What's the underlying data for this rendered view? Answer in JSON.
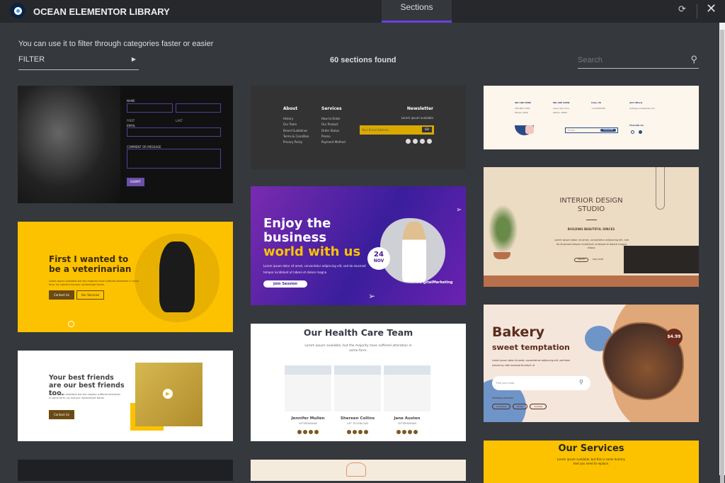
{
  "header": {
    "title": "OCEAN ELEMENTOR LIBRARY",
    "tab": "Sections",
    "sync_icon": "sync-icon",
    "close_icon": "close-icon"
  },
  "toolbar": {
    "hint": "You can use it to filter through categories faster or easier",
    "filter_label": "FILTER",
    "results": "60 sections found",
    "search_placeholder": "Search"
  },
  "colors": {
    "accent": "#6b3fe0",
    "header_bg": "#26282c",
    "body_bg": "#35383d"
  },
  "cards": {
    "contact": {
      "name_label": "NAME",
      "first": "FIRST",
      "last": "LAST",
      "email": "EMAIL",
      "comment": "COMMENT OR MESSAGE",
      "submit": "SUBMIT"
    },
    "vet": {
      "title": "First I wanted to be a veterinarian",
      "text": "Lorem ipsum available but the majority have suffered alteration in some form, by injected humour randomised words.",
      "btn1": "Contact Us",
      "btn2": "Our Services"
    },
    "friends": {
      "title": "Your best friends are our best friends too.",
      "text": "Lorem ipsum available but the majoity suffered alteration in some form, by humour randomised words.",
      "btn": "Contact Us"
    },
    "footer": {
      "about": "About",
      "about_links": [
        "History",
        "Our Team",
        "Brand Guidelines",
        "Terms & Condition",
        "Privacy Policy"
      ],
      "services": "Services",
      "service_links": [
        "How to Order",
        "Our Product",
        "Order Status",
        "Promo",
        "Payment Method"
      ],
      "newsletter": "Newsletter",
      "news_text": "Lorem ipsum available",
      "email_placeholder": "Your Email Address",
      "go": "GO"
    },
    "business": {
      "line1": "Enjoy the",
      "line2": "business",
      "line3": "world with us",
      "text": "Lorem ipsum dolor sit amet, consectetur adipiscing elit, sed do eiusmod tempor incididunt ut labore et dolore magna",
      "btn": "Join Session",
      "day": "24",
      "month": "NOV",
      "tag": "#DigitalMarketing"
    },
    "health": {
      "title": "Our Health Care Team",
      "text": "Lorem ipsum available, but the majority have suffered alteration in some form.",
      "members": [
        {
          "name": "Jennifer Mullen",
          "role": "VETERINARIAN"
        },
        {
          "name": "Shereen Collins",
          "role": "VET TECHNICIAN"
        },
        {
          "name": "Jane Austen",
          "role": "VETERINARIAN"
        }
      ]
    },
    "contactinfo": {
      "cols": [
        {
          "h": "WE ARE HERE",
          "t": "350 Main 55th Street, 0000"
        },
        {
          "h": "WE ARE OPEN",
          "t": "every day from 9AM to 10PM"
        },
        {
          "h": "CALL US",
          "t": "+123456780"
        },
        {
          "h": "SAY HELLO",
          "t": "hello@yourwebsite.com"
        }
      ],
      "follow": "FOLLOW US",
      "subscribe": "SUBSCRIBE",
      "email": "E-mail"
    },
    "interior": {
      "title": "INTERIOR DESIGN STUDIO",
      "sub": "BUILDING BEAUTIFUL SPACES",
      "text": "Lorem ipsum dolor sit amet, consectetur adipiscing elit, sed do eiusmod tempor incididunt ut labore et dolore magna aliqua.",
      "btn1": "SIGN IN",
      "btn2": "READ MORE"
    },
    "bakery": {
      "title": "Bakery",
      "sub": "sweet temptation",
      "text": "Lorem ipsum dolor sit amet, consectetuer adipiscing elit, sed diam nonummy nibh euismod tincidunt ut",
      "search": "Find your treat",
      "trending": "Trending searches",
      "tags": [
        "Cupcakes",
        "Bread",
        "Cookies"
      ],
      "price": "$4.99"
    },
    "services": {
      "title": "Our Services",
      "text": "Lorem ipsum available, but this is some dummy text you need to replace."
    }
  }
}
